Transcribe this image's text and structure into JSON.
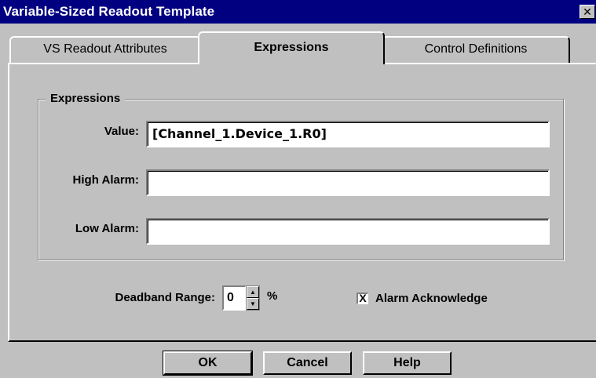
{
  "window": {
    "title": "Variable-Sized Readout Template",
    "close_icon": "close-icon",
    "close_glyph": "✕"
  },
  "tabs": [
    {
      "label": "VS Readout Attributes",
      "active": false
    },
    {
      "label": "Expressions",
      "active": true
    },
    {
      "label": "Control Definitions",
      "active": false
    }
  ],
  "expressions": {
    "group_title": "Expressions",
    "value_label": "Value:",
    "value": "[Channel_1.Device_1.R0]",
    "high_alarm_label": "High Alarm:",
    "high_alarm": "",
    "low_alarm_label": "Low Alarm:",
    "low_alarm": ""
  },
  "deadband": {
    "label": "Deadband Range:",
    "value": "0",
    "unit": "%",
    "up_glyph": "▲",
    "down_glyph": "▼"
  },
  "alarm_ack": {
    "label": "Alarm Acknowledge",
    "checked": true,
    "mark": "X"
  },
  "buttons": {
    "ok": "OK",
    "cancel": "Cancel",
    "help": "Help"
  },
  "colors": {
    "titlebar": "#000080",
    "face": "#c0c0c0"
  }
}
